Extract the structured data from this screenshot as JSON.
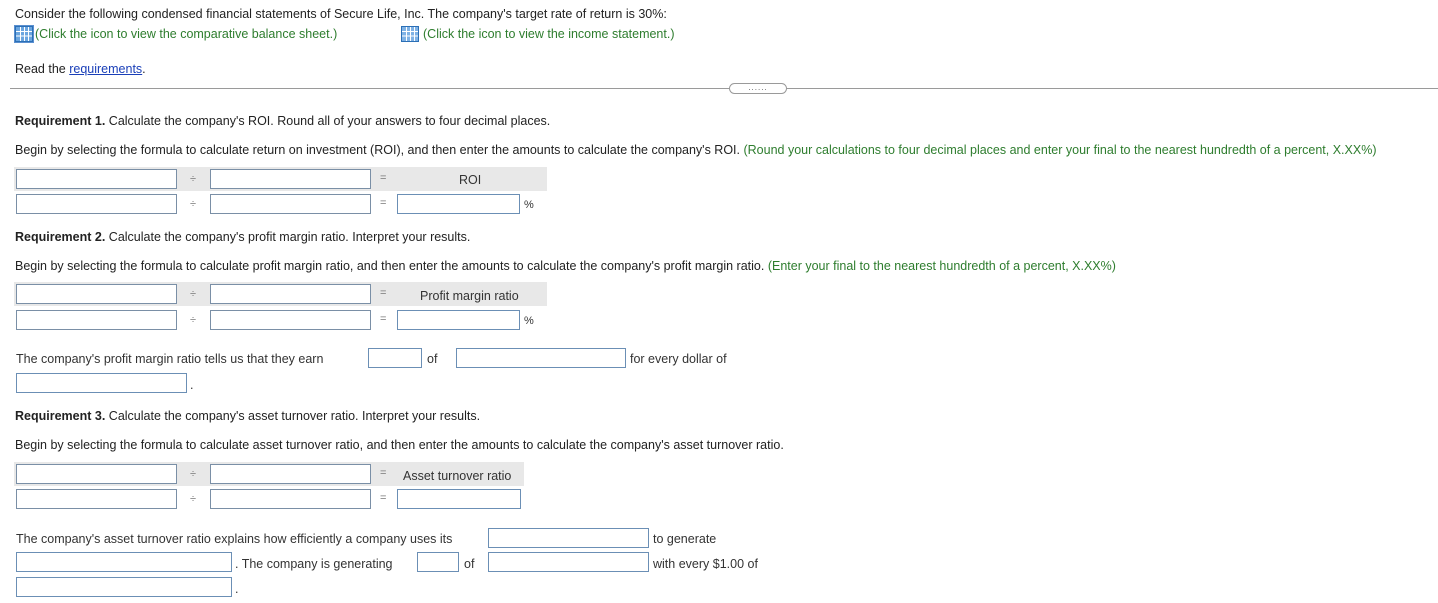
{
  "intro": "Consider the following condensed financial statements of Secure Life, Inc. The company's target rate of return is 30%:",
  "balance_sheet_link": "(Click the icon to view the comparative balance sheet.)",
  "income_statement_link": "(Click the icon to view the income statement.)",
  "read_prefix": "Read the ",
  "requirements_link": "requirements",
  "read_suffix": ".",
  "expander_label": "......",
  "ops": {
    "divide": "÷",
    "equals": "="
  },
  "percent": "%",
  "req1": {
    "heading": "Requirement 1.",
    "text": " Calculate the company's ROI. Round all of your answers to four decimal places.",
    "instruction": "Begin by selecting the formula to calculate return on investment (ROI), and then enter the amounts to calculate the company's ROI.",
    "hint": "(Round your calculations to four decimal places and enter your final to the nearest hundredth of a percent, X.XX%)",
    "result_label": "ROI"
  },
  "req2": {
    "heading": "Requirement 2.",
    "text": " Calculate the company's profit margin ratio. Interpret your results.",
    "instruction": "Begin by selecting the formula to calculate profit margin ratio, and then enter the amounts to calculate the company's profit margin ratio.",
    "hint": "(Enter your final to the nearest hundredth of a percent, X.XX%)",
    "result_label": "Profit margin ratio",
    "interp_prefix": "The company's profit margin ratio tells us that they earn",
    "interp_of": "of",
    "interp_suffix": "for every dollar of",
    "interp_end": "."
  },
  "req3": {
    "heading": "Requirement 3.",
    "text": " Calculate the company's asset turnover ratio. Interpret your results.",
    "instruction": "Begin by selecting the formula to calculate asset turnover ratio, and then enter the amounts to calculate the company's asset turnover ratio.",
    "result_label": "Asset turnover ratio",
    "interp_prefix": "The company's asset turnover ratio explains how efficiently a company uses its",
    "interp_generate": "to generate",
    "interp_generating": ". The company is generating",
    "interp_of": "of",
    "interp_every": "with every $1.00 of",
    "interp_end": "."
  }
}
